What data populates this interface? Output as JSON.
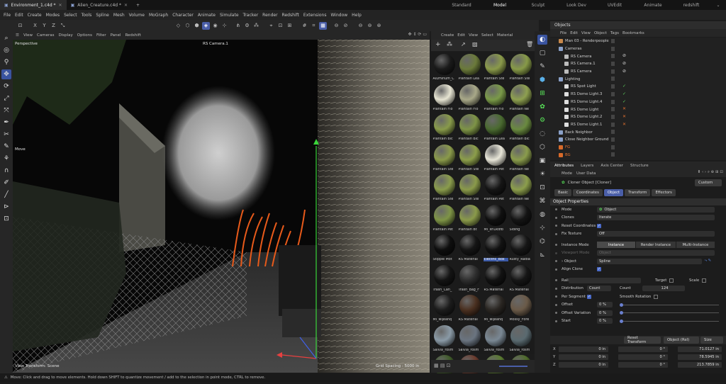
{
  "titlebar": {
    "tabs": [
      {
        "label": "Environment_1.c4d *",
        "active": true
      },
      {
        "label": "Alien_Creature.c4d *",
        "active": false
      }
    ],
    "new_tab_icon": "plus-icon",
    "layouts": [
      "Standard",
      "Model",
      "Sculpt",
      "Look Dev",
      "UVEdit",
      "Animate",
      "redshift"
    ],
    "active_layout": "Model"
  },
  "menubar": [
    "File",
    "Edit",
    "Create",
    "Modes",
    "Select",
    "Tools",
    "Spline",
    "Mesh",
    "Volume",
    "MoGraph",
    "Character",
    "Animate",
    "Simulate",
    "Tracker",
    "Render",
    "Redshift",
    "Extensions",
    "Window",
    "Help"
  ],
  "toolbar": {
    "axis_buttons": [
      "X",
      "Y",
      "Z"
    ]
  },
  "viewport": {
    "menu": [
      "View",
      "Cameras",
      "Display",
      "Options",
      "Filter",
      "Panel",
      "Redshift"
    ],
    "label": "Perspective",
    "camera": "RS Camera.1",
    "move_label": "Move",
    "bottom_left": "View Transform: Scene",
    "grid_spacing": "Grid Spacing : 5000 in"
  },
  "materials": {
    "menu": [
      "Create",
      "Edit",
      "View",
      "Select",
      "Material"
    ],
    "items": [
      {
        "name": "Aluminum_C",
        "color": "#1a1a1a"
      },
      {
        "name": "Plantain Lea",
        "color": "#6b7a3a"
      },
      {
        "name": "Plantain Ste",
        "color": "#8a9a4a"
      },
      {
        "name": "Plantain Ste",
        "color": "#879a48"
      },
      {
        "name": "Plantain Flo",
        "color": "#e6e4d2"
      },
      {
        "name": "Plantain Flo",
        "color": "#a8a888"
      },
      {
        "name": "Plantain Flo",
        "color": "#7a9a48"
      },
      {
        "name": "Plantain Ne",
        "color": "#8ea050"
      },
      {
        "name": "Plantain Bic",
        "color": "#889a4a"
      },
      {
        "name": "Plantain Bic",
        "color": "#7e9446"
      },
      {
        "name": "Plantain Lea",
        "color": "#4a6a30"
      },
      {
        "name": "Plantain Bic",
        "color": "#6a8a40"
      },
      {
        "name": "Plantain Ste",
        "color": "#8a9a4a"
      },
      {
        "name": "Plantain Ste",
        "color": "#8c9e4a"
      },
      {
        "name": "Plantain Pet",
        "color": "#e8e6d8"
      },
      {
        "name": "Plantain Ne",
        "color": "#8a9c4c"
      },
      {
        "name": "Plantain Ste",
        "color": "#8a9c4c"
      },
      {
        "name": "Plantain Ste",
        "color": "#8a9a4a"
      },
      {
        "name": "Plantain Pet",
        "color": "#151515"
      },
      {
        "name": "Plantain Ne",
        "color": "#8c9e4c"
      },
      {
        "name": "Plantain Pet",
        "color": "#7e9446"
      },
      {
        "name": "Plantain Bt",
        "color": "#8a9a4a"
      },
      {
        "name": "MI_xh1kdfb",
        "color": "#101010"
      },
      {
        "name": "Siding",
        "color": "#141414"
      },
      {
        "name": "Stipple Mot",
        "color": "#0e0e0e"
      },
      {
        "name": "RS Material",
        "color": "#151515"
      },
      {
        "name": "Electric_Box",
        "color": "#121212",
        "selected": true
      },
      {
        "name": "Rusty_Radia",
        "color": "#161616"
      },
      {
        "name": "Trash_Can_",
        "color": "#141414"
      },
      {
        "name": "Trash_Bag_F",
        "color": "#2e2e2e"
      },
      {
        "name": "RS Material",
        "color": "#121212"
      },
      {
        "name": "RS Material",
        "color": "#161616"
      },
      {
        "name": "MI_wijeanq",
        "color": "#1c1c1c"
      },
      {
        "name": "RS Material",
        "color": "#4a3020"
      },
      {
        "name": "MI_wijeanq",
        "color": "#2a2622"
      },
      {
        "name": "Mossy_Fore",
        "color": "#6a5a48"
      },
      {
        "name": "Salvia_rosm",
        "color": "#8a9aa6"
      },
      {
        "name": "Salvia_rosm",
        "color": "#6a7480"
      },
      {
        "name": "Salvia_rosm",
        "color": "#7a8894"
      },
      {
        "name": "Salvia_rosm",
        "color": "#5a6a70"
      },
      {
        "name": "Salvia_rosm",
        "color": "#3e5a28"
      },
      {
        "name": "Salvia_rosm",
        "color": "#6a3a2c"
      },
      {
        "name": "Salvia_rosm",
        "color": "#5a7a30"
      },
      {
        "name": "Salvia_rosm",
        "color": "#4e6a2a"
      }
    ]
  },
  "objects": {
    "header": "Objects",
    "menu": [
      "File",
      "Edit",
      "View",
      "Object",
      "Tags",
      "Bookmarks"
    ],
    "rows": [
      {
        "label": "Man 03 - Renderpeople",
        "indent": 0,
        "icon_color": "#c8884a",
        "status": "",
        "status_color": ""
      },
      {
        "label": "Cameras",
        "indent": 0,
        "icon_color": "#8aa0c8",
        "status": "",
        "status_color": ""
      },
      {
        "label": "RS Camera",
        "indent": 1,
        "icon_color": "#bbbbbb",
        "status": "⊘",
        "status_color": "#ddd"
      },
      {
        "label": "RS Camera.1",
        "indent": 1,
        "icon_color": "#bbbbbb",
        "status": "⊘",
        "status_color": "#ddd"
      },
      {
        "label": "RS Camera",
        "indent": 1,
        "icon_color": "#bbbbbb",
        "status": "⊘",
        "status_color": "#ddd"
      },
      {
        "label": "Lighting",
        "indent": 0,
        "icon_color": "#8aa0c8",
        "status": "",
        "status_color": ""
      },
      {
        "label": "RS Spot Light",
        "indent": 1,
        "icon_color": "#dddddd",
        "status": "✓",
        "status_color": "#5fd35f"
      },
      {
        "label": "RS Dome Light.3",
        "indent": 1,
        "icon_color": "#dddddd",
        "status": "✓",
        "status_color": "#5fd35f"
      },
      {
        "label": "RS Dome Light.4",
        "indent": 1,
        "icon_color": "#dddddd",
        "status": "✓",
        "status_color": "#5fd35f"
      },
      {
        "label": "RS Dome Light",
        "indent": 1,
        "icon_color": "#dddddd",
        "status": "✕",
        "status_color": "#e07030"
      },
      {
        "label": "RS Dome Light.2",
        "indent": 1,
        "icon_color": "#dddddd",
        "status": "✕",
        "status_color": "#e07030"
      },
      {
        "label": "RS Dome Light.1",
        "indent": 1,
        "icon_color": "#dddddd",
        "status": "✕",
        "status_color": "#e07030"
      },
      {
        "label": "Back Neighbor",
        "indent": 0,
        "icon_color": "#8aa0c8",
        "status": "",
        "status_color": ""
      },
      {
        "label": "Close Neighbor Ground",
        "indent": 0,
        "icon_color": "#8aa0c8",
        "status": "",
        "status_color": ""
      },
      {
        "label": "FG",
        "indent": 0,
        "icon_color": "#d86a2a",
        "status": "",
        "status_color": "",
        "label_color": "#e07030"
      },
      {
        "label": "BG",
        "indent": 0,
        "icon_color": "#d86a2a",
        "status": "",
        "status_color": "",
        "label_color": "#e07030"
      }
    ]
  },
  "attributes": {
    "tabs": [
      "Attributes",
      "Layers",
      "Axis Center",
      "Structure"
    ],
    "menu": [
      "Mode",
      "User Data"
    ],
    "object_title": "Cloner Object [Cloner]",
    "preset": "Custom",
    "subtabs": [
      "Basic",
      "Coordinates",
      "Object",
      "Transform",
      "Effectors"
    ],
    "active_subtab": "Object",
    "section": "Object Properties",
    "mode_label": "Mode",
    "mode_value": "Object",
    "clones_label": "Clones",
    "clones_value": "Iterate",
    "reset_label": "Reset Coordinates",
    "fix_label": "Fix Texture",
    "fix_value": "Off",
    "instance_label": "Instance Mode",
    "instance_options": [
      "Instance",
      "Render Instance",
      "Multi-Instance"
    ],
    "viewport_mode_label": "Viewport Mode",
    "viewport_mode_value": "Object",
    "object_label": "Object",
    "object_value": "Spline",
    "align_label": "Align Clone",
    "rail_label": "Rail",
    "target_label": "Target",
    "scale_label": "Scale",
    "distribution_label": "Distribution",
    "distribution_value": "Count",
    "count_label": "Count",
    "count_value": "124",
    "per_segment_label": "Per Segment",
    "smooth_label": "Smooth Rotation",
    "offset_label": "Offset",
    "offset_value": "0 %",
    "offset_var_label": "Offset Variation",
    "offset_var_value": "0 %",
    "start_label": "Start",
    "start_value": "0 %"
  },
  "coordinates": {
    "reset_button": "Reset Transform",
    "mode": "Object (Rel)",
    "size": "Size",
    "rows": [
      {
        "axis": "X",
        "pos": "0 in",
        "rot": "0 °",
        "size": "71.0127 in"
      },
      {
        "axis": "Y",
        "pos": "0 in",
        "rot": "0 °",
        "size": "78.5945 in"
      },
      {
        "axis": "Z",
        "pos": "0 in",
        "rot": "0 °",
        "size": "213.7859 in"
      }
    ]
  },
  "status": "Move: Click and drag to move elements. Hold down SHIFT to quantize movement / add to the selection in point mode, CTRL to remove."
}
